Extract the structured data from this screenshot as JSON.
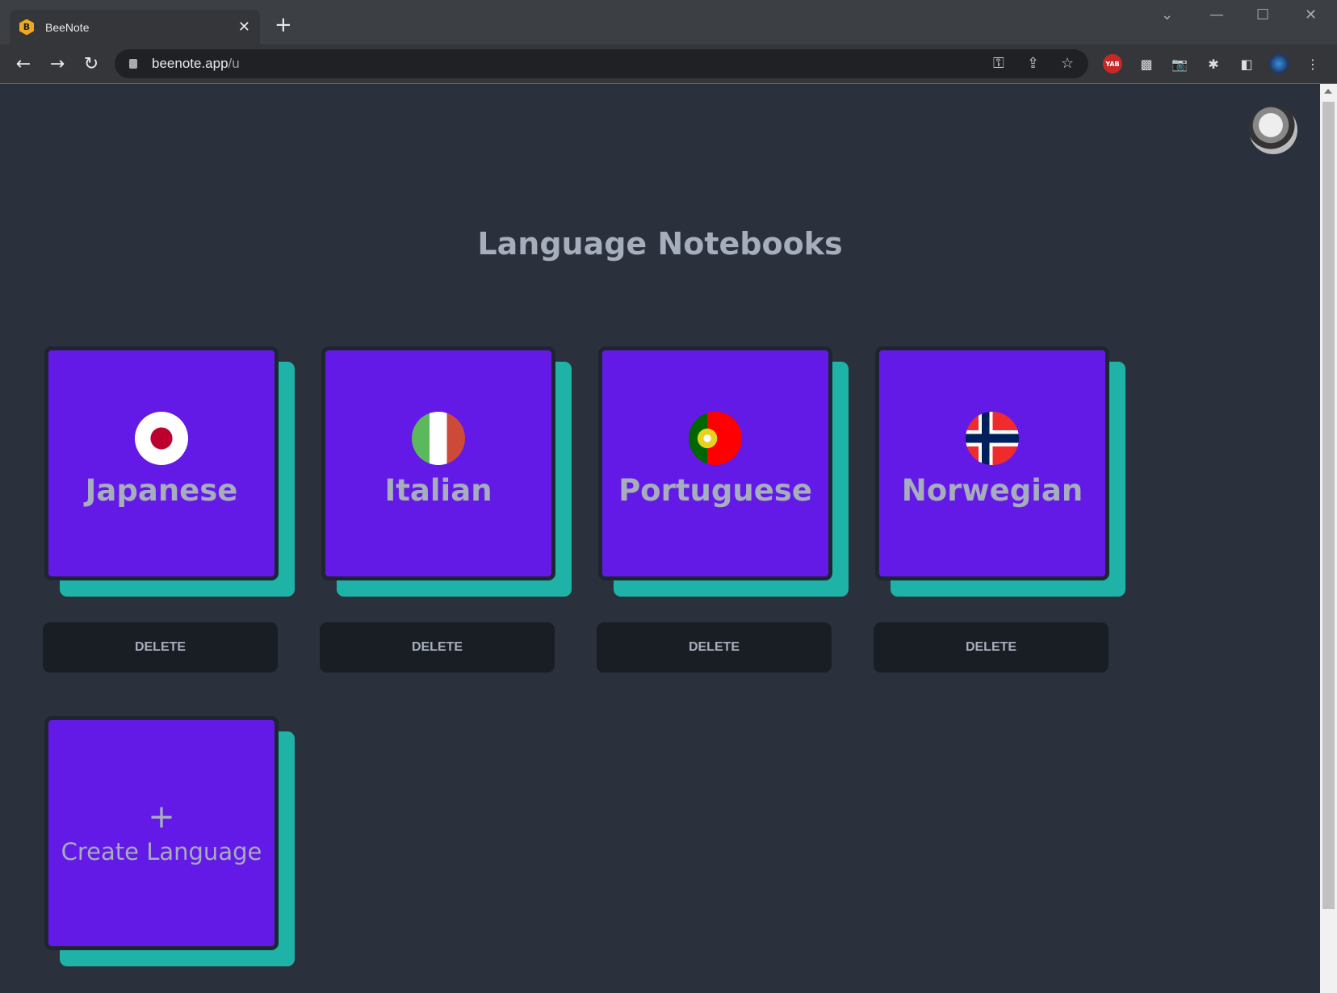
{
  "browser": {
    "tab_title": "BeeNote",
    "favicon_letter": "B",
    "url_host": "beenote.app",
    "url_path": "/u",
    "extensions": [
      "yab-icon",
      "screen-capture-icon",
      "camera-icon",
      "extensions-icon",
      "side-panel-icon",
      "profile-icon",
      "menu-icon"
    ]
  },
  "page": {
    "title": "Language Notebooks"
  },
  "languages": [
    {
      "name": "Japanese",
      "flag": "japan-flag-icon",
      "delete_label": "DELETE"
    },
    {
      "name": "Italian",
      "flag": "italy-flag-icon",
      "delete_label": "DELETE"
    },
    {
      "name": "Portuguese",
      "flag": "portugal-flag-icon",
      "delete_label": "DELETE"
    },
    {
      "name": "Norwegian",
      "flag": "norway-flag-icon",
      "delete_label": "DELETE"
    }
  ],
  "create": {
    "icon": "+",
    "label": "Create Language"
  },
  "colors": {
    "background": "#2a303c",
    "card": "#641ae6",
    "card_shadow": "#1fb2a6",
    "text": "#a6adbb",
    "button": "#191d24"
  }
}
